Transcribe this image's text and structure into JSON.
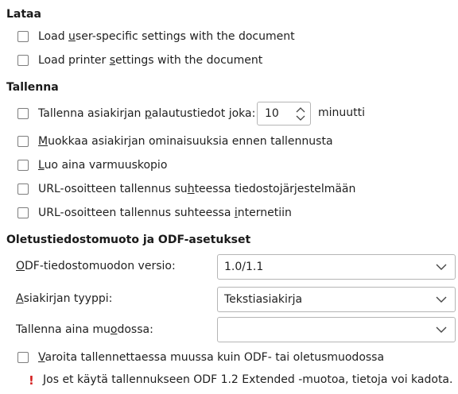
{
  "load": {
    "title": "Lataa",
    "user_settings": {
      "pre": "Load ",
      "u": "u",
      "post": "ser-specific settings with the document"
    },
    "printer_settings": {
      "pre": "Load printer ",
      "u": "s",
      "post": "ettings with the document"
    }
  },
  "save": {
    "title": "Tallenna",
    "autosave": {
      "pre": "Tallenna asiakirjan ",
      "u": "p",
      "post": "alautustiedot joka:"
    },
    "autosave_minutes": "10",
    "autosave_unit": "minuutti",
    "edit_properties": {
      "pre": "",
      "u": "M",
      "post": "uokkaa asiakirjan ominaisuuksia ennen tallennusta"
    },
    "backup": {
      "pre": "",
      "u": "L",
      "post": "uo aina varmuuskopio"
    },
    "url_filesystem": {
      "pre": "URL-osoitteen tallennus su",
      "u": "h",
      "post": "teessa tiedostojärjestelmään"
    },
    "url_internet": {
      "pre": "URL-osoitteen tallennus suhteessa ",
      "u": "i",
      "post": "nternetiin"
    }
  },
  "defaults": {
    "title": "Oletustiedostomuoto ja ODF-asetukset",
    "odf_version": {
      "pre": "",
      "u": "O",
      "post": "DF-tiedostomuodon versio:",
      "value": "1.0/1.1"
    },
    "doc_type": {
      "pre": "",
      "u": "A",
      "post": "siakirjan tyyppi:",
      "value": "Tekstiasiakirja"
    },
    "always_save_as": {
      "pre": "Tallenna aina mu",
      "u": "o",
      "post": "dossa:",
      "value": ""
    },
    "warn_non_odf": {
      "pre": "",
      "u": "V",
      "post": "aroita tallennettaessa muussa kuin ODF- tai oletusmuodossa"
    },
    "warning_icon": "!",
    "warning_text": "Jos et käytä tallennukseen ODF 1.2 Extended -muotoa, tietoja voi kadota."
  },
  "icons": {
    "spin_up": "chevron-up-icon",
    "spin_down": "chevron-down-icon",
    "combo": "chevron-down-icon",
    "warning": "exclamation-icon"
  },
  "colors": {
    "warning": "#d42020",
    "border": "#b5b5b5"
  }
}
